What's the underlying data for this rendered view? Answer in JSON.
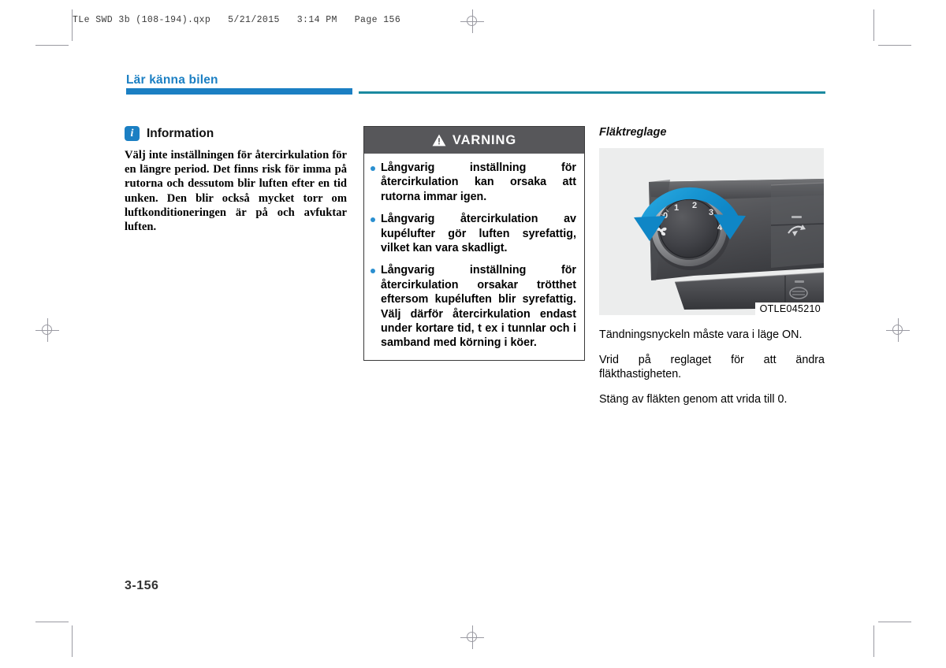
{
  "print_header": "TLe SWD 3b (108-194).qxp   5/21/2015   3:14 PM   Page 156",
  "chapter": {
    "title": "Lär känna bilen"
  },
  "colors": {
    "accent_blue": "#1b7fc3",
    "rule_teal": "#1b8aa0",
    "warning_header": "#57575a",
    "bullet_blue": "#2a8fd0"
  },
  "information": {
    "icon": "info-icon",
    "icon_glyph": "i",
    "title": "Information",
    "body": "Välj inte inställningen för återcirkulation för en längre period. Det finns risk för imma på rutorna och dessutom blir luften efter en tid unken. Den blir också mycket torr om luftkonditioneringen är på och avfuktar luften."
  },
  "warning": {
    "icon": "warning-triangle-icon",
    "title": "VARNING",
    "items": [
      "Långvarig inställning för återcirkulation kan orsaka att rutorna immar igen.",
      "Långvarig återcirkulation av kupélufter gör luften syrefattig, vilket kan vara skadligt.",
      "Långvarig inställning för återcirkulation orsakar trötthet eftersom kupéluften blir syrefattig. Välj därför återcirkulation endast under kortare tid, t ex i tunnlar och i samband med körning i köer."
    ]
  },
  "fan_section": {
    "title": "Fläktreglage",
    "figure": {
      "name": "fan-control-knob-photo",
      "caption": "OTLE045210",
      "knob_labels": [
        "0",
        "1",
        "2",
        "3",
        "4"
      ],
      "knob_icon": "fan-icon",
      "arrow_icon": "rotate-both-ways-arrow-icon",
      "arrow_color": "#1b9fd8",
      "button_icons": [
        "recirculation-icon",
        "rear-defrost-icon"
      ]
    },
    "paragraphs": [
      "Tändningsnyckeln måste vara i läge ON.",
      "Vrid på reglaget för att ändra fläkthastigheten.",
      "Stäng av fläkten genom att vrida till 0."
    ]
  },
  "footer": {
    "page_number": "3-156"
  }
}
